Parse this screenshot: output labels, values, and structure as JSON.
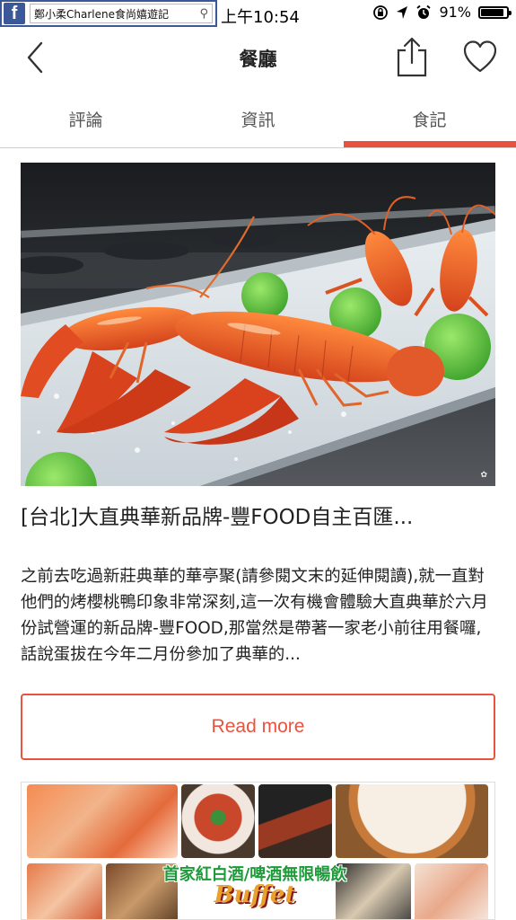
{
  "status_bar": {
    "search_query": "鄭小柔Charlene食尚嬉遊記",
    "time": "上午10:54",
    "battery_percent": "91%",
    "battery_level": 0.91,
    "icons": [
      "facebook-icon",
      "search-icon",
      "rotation-lock-icon",
      "location-arrow-icon",
      "alarm-icon",
      "battery-icon"
    ]
  },
  "nav": {
    "title": "餐廳",
    "icons": [
      "back-chevron-icon",
      "share-icon",
      "heart-icon"
    ]
  },
  "tabs": [
    {
      "label": "評論",
      "active": false
    },
    {
      "label": "資訊",
      "active": false
    },
    {
      "label": "食記",
      "active": true
    }
  ],
  "article": {
    "title": "[台北]大直典華新品牌-豐FOOD自主百匯...",
    "excerpt": "之前去吃過新莊典華的華亭聚(請參閱文末的延伸閱讀),就一直對他們的烤櫻桃鴨印象非常深刻,這一次有機會體驗大直典華於六月份試營運的新品牌-豐FOOD,那當然是帶著一家老小前往用餐囉,話說蛋拔在今年二月份參加了典華的...",
    "read_more_label": "Read more"
  },
  "second_card": {
    "banner_text": "首家紅白酒/啤酒無限暢飲",
    "banner_subtext": "Buffet"
  },
  "colors": {
    "accent": "#e8533f",
    "facebook": "#3b5998",
    "banner_green": "#1f9a3a"
  }
}
